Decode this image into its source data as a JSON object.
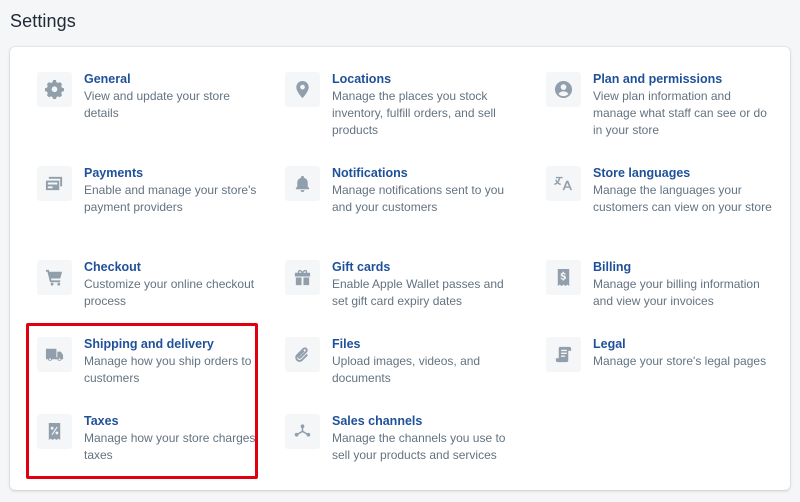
{
  "page": {
    "title": "Settings"
  },
  "colors": {
    "link": "#1f5199",
    "description": "#637381",
    "icon": "#919eab",
    "icon_bg": "#f4f6f8",
    "highlight": "#e0000f"
  },
  "settings": {
    "general": {
      "title": "General",
      "description": "View and update your store details",
      "icon": "gear-icon"
    },
    "locations": {
      "title": "Locations",
      "description": "Manage the places you stock inventory, fulfill orders, and sell products",
      "icon": "location-pin-icon"
    },
    "plan": {
      "title": "Plan and permissions",
      "description": "View plan information and manage what staff can see or do in your store",
      "icon": "user-circle-icon"
    },
    "payments": {
      "title": "Payments",
      "description": "Enable and manage your store's payment providers",
      "icon": "payment-card-icon"
    },
    "notifications": {
      "title": "Notifications",
      "description": "Manage notifications sent to you and your customers",
      "icon": "bell-icon"
    },
    "languages": {
      "title": "Store languages",
      "description": "Manage the languages your customers can view on your store",
      "icon": "translate-icon"
    },
    "checkout": {
      "title": "Checkout",
      "description": "Customize your online checkout process",
      "icon": "cart-icon"
    },
    "gift_cards": {
      "title": "Gift cards",
      "description": "Enable Apple Wallet passes and set gift card expiry dates",
      "icon": "gift-icon"
    },
    "billing": {
      "title": "Billing",
      "description": "Manage your billing information and view your invoices",
      "icon": "dollar-receipt-icon"
    },
    "shipping": {
      "title": "Shipping and delivery",
      "description": "Manage how you ship orders to customers",
      "icon": "truck-icon"
    },
    "files": {
      "title": "Files",
      "description": "Upload images, videos, and documents",
      "icon": "paperclip-icon"
    },
    "legal": {
      "title": "Legal",
      "description": "Manage your store's legal pages",
      "icon": "scroll-icon"
    },
    "taxes": {
      "title": "Taxes",
      "description": "Manage how your store charges taxes",
      "icon": "tax-receipt-icon"
    },
    "sales_channels": {
      "title": "Sales channels",
      "description": "Manage the channels you use to sell your products and services",
      "icon": "channels-icon"
    }
  }
}
